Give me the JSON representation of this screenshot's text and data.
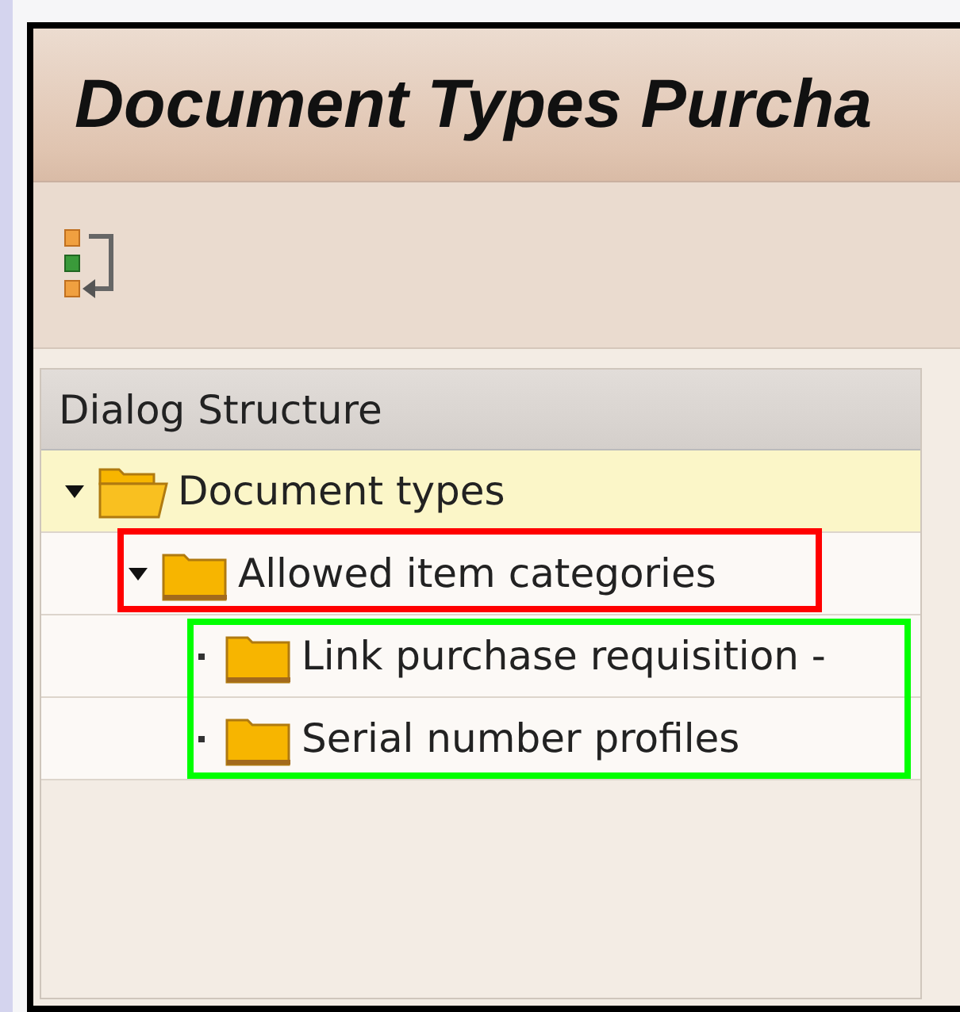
{
  "window": {
    "title": "Document Types Purcha"
  },
  "toolbar": {
    "buttons": [
      {
        "kind": "structure"
      }
    ]
  },
  "dialog_structure": {
    "header": "Dialog Structure",
    "tree": [
      {
        "label": "Document types",
        "selected": true,
        "expanded": true,
        "children": [
          {
            "label": "Allowed item categories",
            "selected": false,
            "expanded": true,
            "children": [
              {
                "label": "Link purchase requisition -",
                "selected": false
              },
              {
                "label": "Serial number profiles",
                "selected": false
              }
            ]
          }
        ]
      }
    ]
  },
  "annotations": [
    {
      "color": "#ff0000"
    },
    {
      "color": "#00ff00"
    }
  ]
}
